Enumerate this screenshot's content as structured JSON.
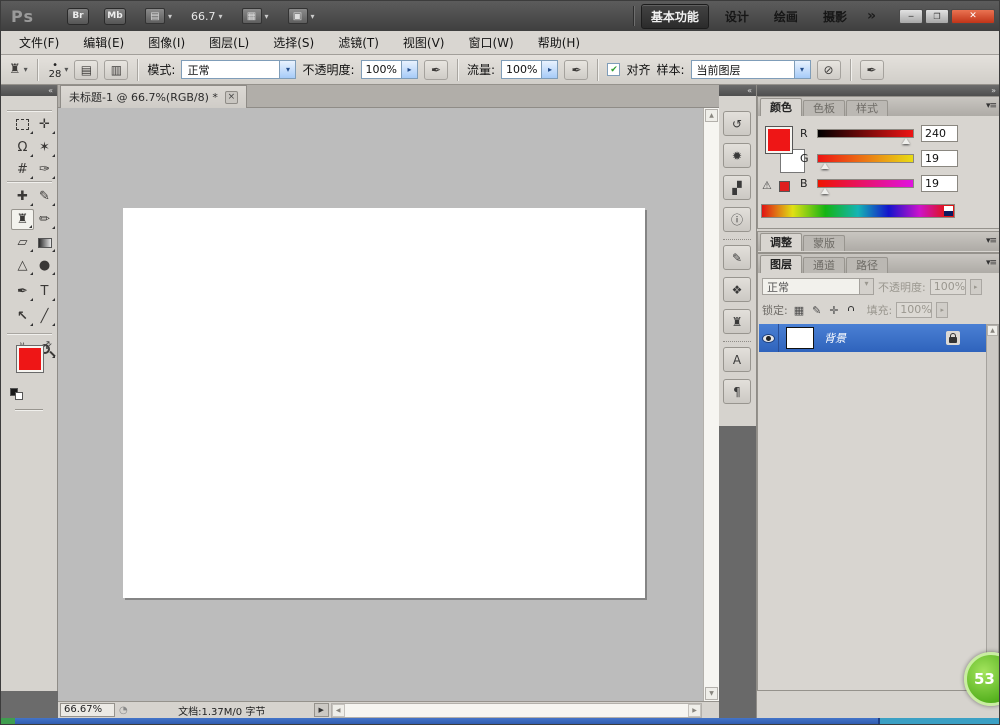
{
  "titlebar": {
    "logo": "Ps",
    "br_label": "Br",
    "mb_label": "Mb",
    "zoom_level": "66.7",
    "workspaces": [
      {
        "label": "基本功能"
      },
      {
        "label": "设计"
      },
      {
        "label": "绘画"
      },
      {
        "label": "摄影"
      }
    ]
  },
  "menubar": {
    "items": [
      {
        "label": "文件(F)"
      },
      {
        "label": "编辑(E)"
      },
      {
        "label": "图像(I)"
      },
      {
        "label": "图层(L)"
      },
      {
        "label": "选择(S)"
      },
      {
        "label": "滤镜(T)"
      },
      {
        "label": "视图(V)"
      },
      {
        "label": "窗口(W)"
      },
      {
        "label": "帮助(H)"
      }
    ]
  },
  "optionsbar": {
    "brush_size": "28",
    "mode_label": "模式:",
    "mode_value": "正常",
    "opacity_label": "不透明度:",
    "opacity_value": "100%",
    "flow_label": "流量:",
    "flow_value": "100%",
    "align_label": "对齐",
    "sample_label": "样本:",
    "sample_value": "当前图层"
  },
  "toolbox": {
    "tools": [
      {
        "name": "rectangular-marquee",
        "glyph": ""
      },
      {
        "name": "move",
        "glyph": "✛"
      },
      {
        "name": "lasso",
        "glyph": "Ω"
      },
      {
        "name": "quick-selection",
        "glyph": "✶"
      },
      {
        "name": "crop",
        "glyph": "#"
      },
      {
        "name": "eyedropper",
        "glyph": "✑"
      },
      {
        "name": "spot-healing-brush",
        "glyph": "✚"
      },
      {
        "name": "brush",
        "glyph": "✎"
      },
      {
        "name": "clone-stamp",
        "glyph": "♜"
      },
      {
        "name": "history-brush",
        "glyph": "✏"
      },
      {
        "name": "eraser",
        "glyph": "▱"
      },
      {
        "name": "gradient",
        "glyph": ""
      },
      {
        "name": "blur",
        "glyph": "△"
      },
      {
        "name": "burn",
        "glyph": "●"
      },
      {
        "name": "pen",
        "glyph": "✒"
      },
      {
        "name": "type",
        "glyph": "T"
      },
      {
        "name": "path-selection",
        "glyph": "↖"
      },
      {
        "name": "line",
        "glyph": "╱"
      },
      {
        "name": "hand",
        "glyph": "✌"
      },
      {
        "name": "zoom",
        "glyph": ""
      }
    ]
  },
  "document": {
    "tab_title": "未标题-1 @ 66.7%(RGB/8) *"
  },
  "statusbar": {
    "zoom": "66.67%",
    "doc_info": "文档:1.37M/0 字节"
  },
  "color_panel": {
    "tabs": [
      "颜色",
      "色板",
      "样式"
    ],
    "channels": [
      {
        "label": "R",
        "value": "240"
      },
      {
        "label": "G",
        "value": "19"
      },
      {
        "label": "B",
        "value": "19"
      }
    ]
  },
  "adjustments_panel": {
    "tabs": [
      "调整",
      "蒙版"
    ]
  },
  "layers_panel": {
    "tabs": [
      "图层",
      "通道",
      "路径"
    ],
    "blend_mode": "正常",
    "opacity_label": "不透明度:",
    "opacity_value": "100%",
    "lock_label": "锁定:",
    "fill_label": "填充:",
    "fill_value": "100%",
    "layers": [
      {
        "name": "背景"
      }
    ]
  },
  "dock": {
    "icons": [
      {
        "name": "history",
        "glyph": "↺"
      },
      {
        "name": "styles",
        "glyph": "✹"
      },
      {
        "name": "histogram",
        "glyph": "▞"
      },
      {
        "name": "info",
        "glyph": "ⓘ"
      },
      {
        "name": "brush-panel",
        "glyph": "✎"
      },
      {
        "name": "clone-source",
        "glyph": "❖"
      },
      {
        "name": "animation",
        "glyph": "♜"
      },
      {
        "name": "character",
        "glyph": "A"
      },
      {
        "name": "paragraph",
        "glyph": "¶"
      }
    ]
  },
  "icons": {
    "caret_down": "▾",
    "view_extras": "▤",
    "arrange_documents": "▦",
    "screen_mode": "▣",
    "minimize": "─",
    "restore": "❐",
    "close": "✕",
    "more": "»",
    "tool_preset_stamp": "♜",
    "panel_toggle_a": "▤",
    "panel_toggle_b": "▥",
    "airbrush": "✒",
    "tablet_pressure": "✒",
    "ignore_adjustments": "⊘",
    "check": "✔",
    "spin_right": "▸",
    "scroll_up": "▲",
    "scroll_down": "▼",
    "scroll_left": "◀",
    "scroll_right": "▶",
    "play": "▶",
    "collapse_left": "«",
    "collapse_right": "»",
    "panel_menu": "▾≡",
    "tab_close": "×",
    "gamut_warning": "⚠",
    "lock_transparent": "▦",
    "lock_brush": "✎",
    "lock_move": "✛",
    "status_clock": "◔",
    "brush_dot": "•",
    "swap_colors": "⇄"
  },
  "overlay_badge": {
    "value": "53"
  },
  "colors": {
    "foreground": "#ee1616",
    "background_swatch": "#ffffff",
    "selected_layer": "#3a70c8",
    "close_button": "#cf4024",
    "taskbar": "#2d5fb7",
    "taskbar_segment": "#36a0c8",
    "badge_green": "#62c22e"
  }
}
